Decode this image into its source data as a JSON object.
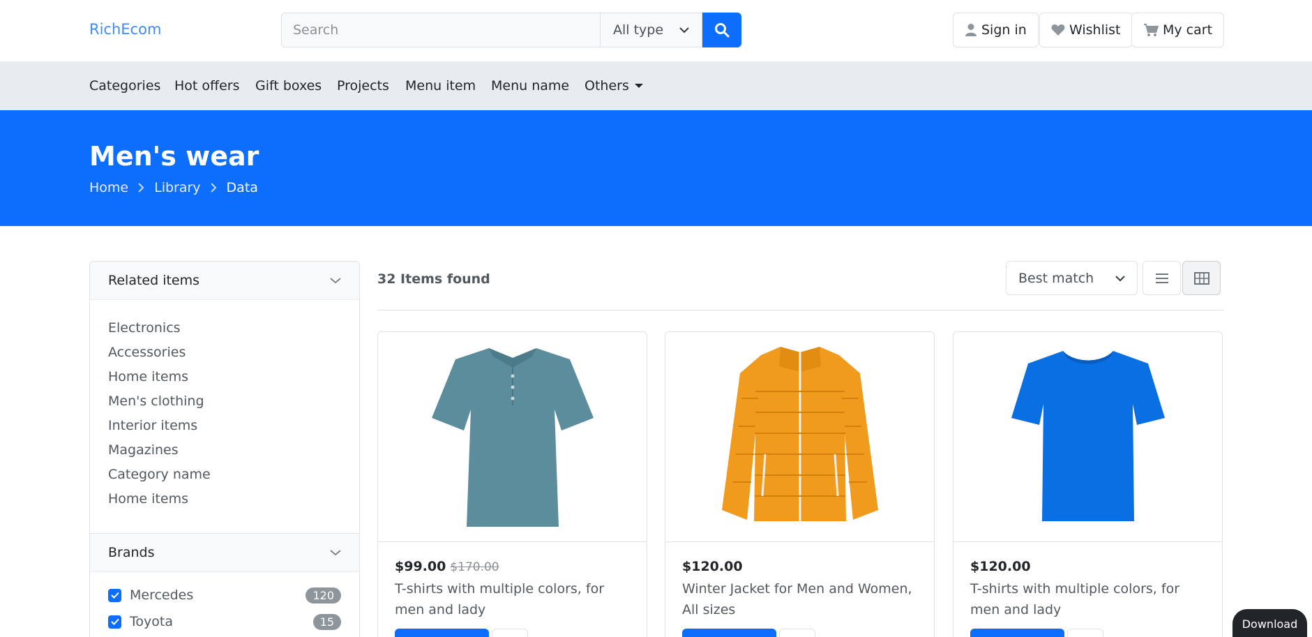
{
  "header": {
    "logo": "RichEcom",
    "search_placeholder": "Search",
    "type_select": "All type",
    "sign_in": "Sign in",
    "wishlist": "Wishlist",
    "cart": "My cart"
  },
  "nav": {
    "items": [
      "Categories",
      "Hot offers",
      "Gift boxes",
      "Projects",
      "Menu item",
      "Menu name",
      "Others"
    ]
  },
  "banner": {
    "title": "Men's wear",
    "breadcrumbs": [
      "Home",
      "Library",
      "Data"
    ]
  },
  "sidebar": {
    "related_title": "Related items",
    "related_items": [
      "Electronics",
      "Accessories",
      "Home items",
      "Men's clothing",
      "Interior items",
      "Magazines",
      "Category name",
      "Home items"
    ],
    "brands_title": "Brands",
    "brands": [
      {
        "name": "Mercedes",
        "count": "120",
        "checked": true
      },
      {
        "name": "Toyota",
        "count": "15",
        "checked": true
      }
    ]
  },
  "main": {
    "items_found": "32 Items found",
    "sort": "Best match",
    "products": [
      {
        "price": "$99.00",
        "old_price": "$170.00",
        "title": "T-shirts with multiple colors, for men and lady",
        "image": "polo-shirt-teal"
      },
      {
        "price": "$120.00",
        "old_price": "",
        "title": "Winter Jacket for Men and Women, All sizes",
        "image": "puffer-jacket-orange"
      },
      {
        "price": "$120.00",
        "old_price": "",
        "title": "T-shirts with multiple colors, for men and lady",
        "image": "tshirt-blue"
      }
    ]
  },
  "download_label": "Download",
  "colors": {
    "primary": "#0d6efd",
    "nav_bg": "#e9ecef",
    "dark": "#212529"
  }
}
